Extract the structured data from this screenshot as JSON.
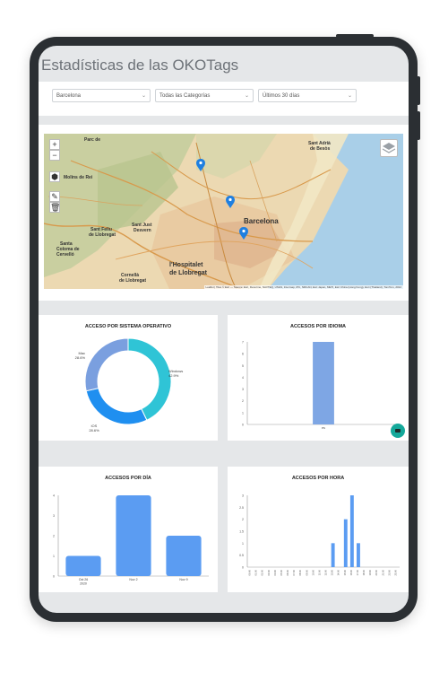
{
  "page": {
    "title": "Estadísticas de las OKOTags"
  },
  "filters": {
    "city": "Barcelona",
    "category": "Todas las Categorías",
    "period": "Últimos 30 días"
  },
  "map": {
    "zoom_in": "+",
    "zoom_out": "−",
    "places": {
      "barcelona": "Barcelona",
      "hospitalet_1": "l'Hospitalet",
      "hospitalet_2": "de Llobregat",
      "sant_just_1": "Sant Just",
      "sant_just_2": "Desvern",
      "sant_feliu_1": "Sant Feliu",
      "sant_feliu_2": "de Llobregat",
      "sant_adria_1": "Sant Adrià",
      "sant_adria_2": "de Besòs",
      "cornella_1": "Cornellà",
      "cornella_2": "de Llobregat",
      "colonia_1": "Santa",
      "colonia_2": "Coloma de",
      "colonia_3": "Cervelló",
      "molins": "Molins de Rei",
      "parc": "Parc de"
    },
    "attribution": "Leaflet | Tiles © Esri — Source: Esri, DeLorme, NAVTEQ, USGS, Intermap, iPC, NRCAN, Esri Japan, METI, Esri China (Hong Kong), Esri (Thailand), TomTom, 2012"
  },
  "colors": {
    "donut": [
      "#2fc4d6",
      "#1f8ff0",
      "#7a9fdf"
    ],
    "bars": "#5b9cf2",
    "idioma": "#7ea6e4"
  },
  "charts": {
    "so": {
      "title": "ACCESO POR SISTEMA OPERATIVO"
    },
    "idioma": {
      "title": "ACCESOS POR IDIOMA"
    },
    "dia": {
      "title": "ACCESOS POR DÍA"
    },
    "hora": {
      "title": "ACCESOS POR HORA"
    }
  },
  "chart_data": [
    {
      "type": "pie",
      "title": "ACCESO POR SISTEMA OPERATIVO",
      "categories": [
        "Windows",
        "iOS",
        "Mac"
      ],
      "values": [
        42.9,
        28.6,
        28.6
      ],
      "labels": [
        "Windows\n42.9%",
        "iOS\n28.6%",
        "Mac\n28.6%"
      ]
    },
    {
      "type": "bar",
      "title": "ACCESOS POR IDIOMA",
      "categories": [
        "es"
      ],
      "values": [
        7
      ],
      "ylim": [
        0,
        7
      ],
      "yticks": [
        "0",
        "1",
        "2",
        "3",
        "4",
        "5",
        "6",
        "7"
      ]
    },
    {
      "type": "bar",
      "title": "ACCESOS POR DÍA",
      "categories": [
        "Oct 26\n2020",
        "Nov 2",
        "Nov 9"
      ],
      "values": [
        1,
        4,
        2
      ],
      "ylim": [
        0,
        4
      ],
      "yticks": [
        "0",
        "1",
        "2",
        "3",
        "4"
      ]
    },
    {
      "type": "bar",
      "title": "ACCESOS POR HORA",
      "categories": [
        "00:00",
        "01:00",
        "02:00",
        "03:00",
        "04:00",
        "05:00",
        "06:00",
        "07:00",
        "08:00",
        "09:00",
        "10:00",
        "11:00",
        "12:00",
        "13:00",
        "14:00",
        "15:00",
        "16:00",
        "17:00",
        "18:00",
        "19:00",
        "20:00",
        "21:00",
        "22:00",
        "23:00"
      ],
      "values": [
        0,
        0,
        0,
        0,
        0,
        0,
        0,
        0,
        0,
        0,
        0,
        0,
        0,
        1,
        0,
        2,
        3,
        1,
        0,
        0,
        0,
        0,
        0,
        0
      ],
      "ylim": [
        0,
        3
      ],
      "yticks": [
        "0",
        "0.5",
        "1",
        "1.5",
        "2",
        "2.5",
        "3"
      ]
    }
  ]
}
